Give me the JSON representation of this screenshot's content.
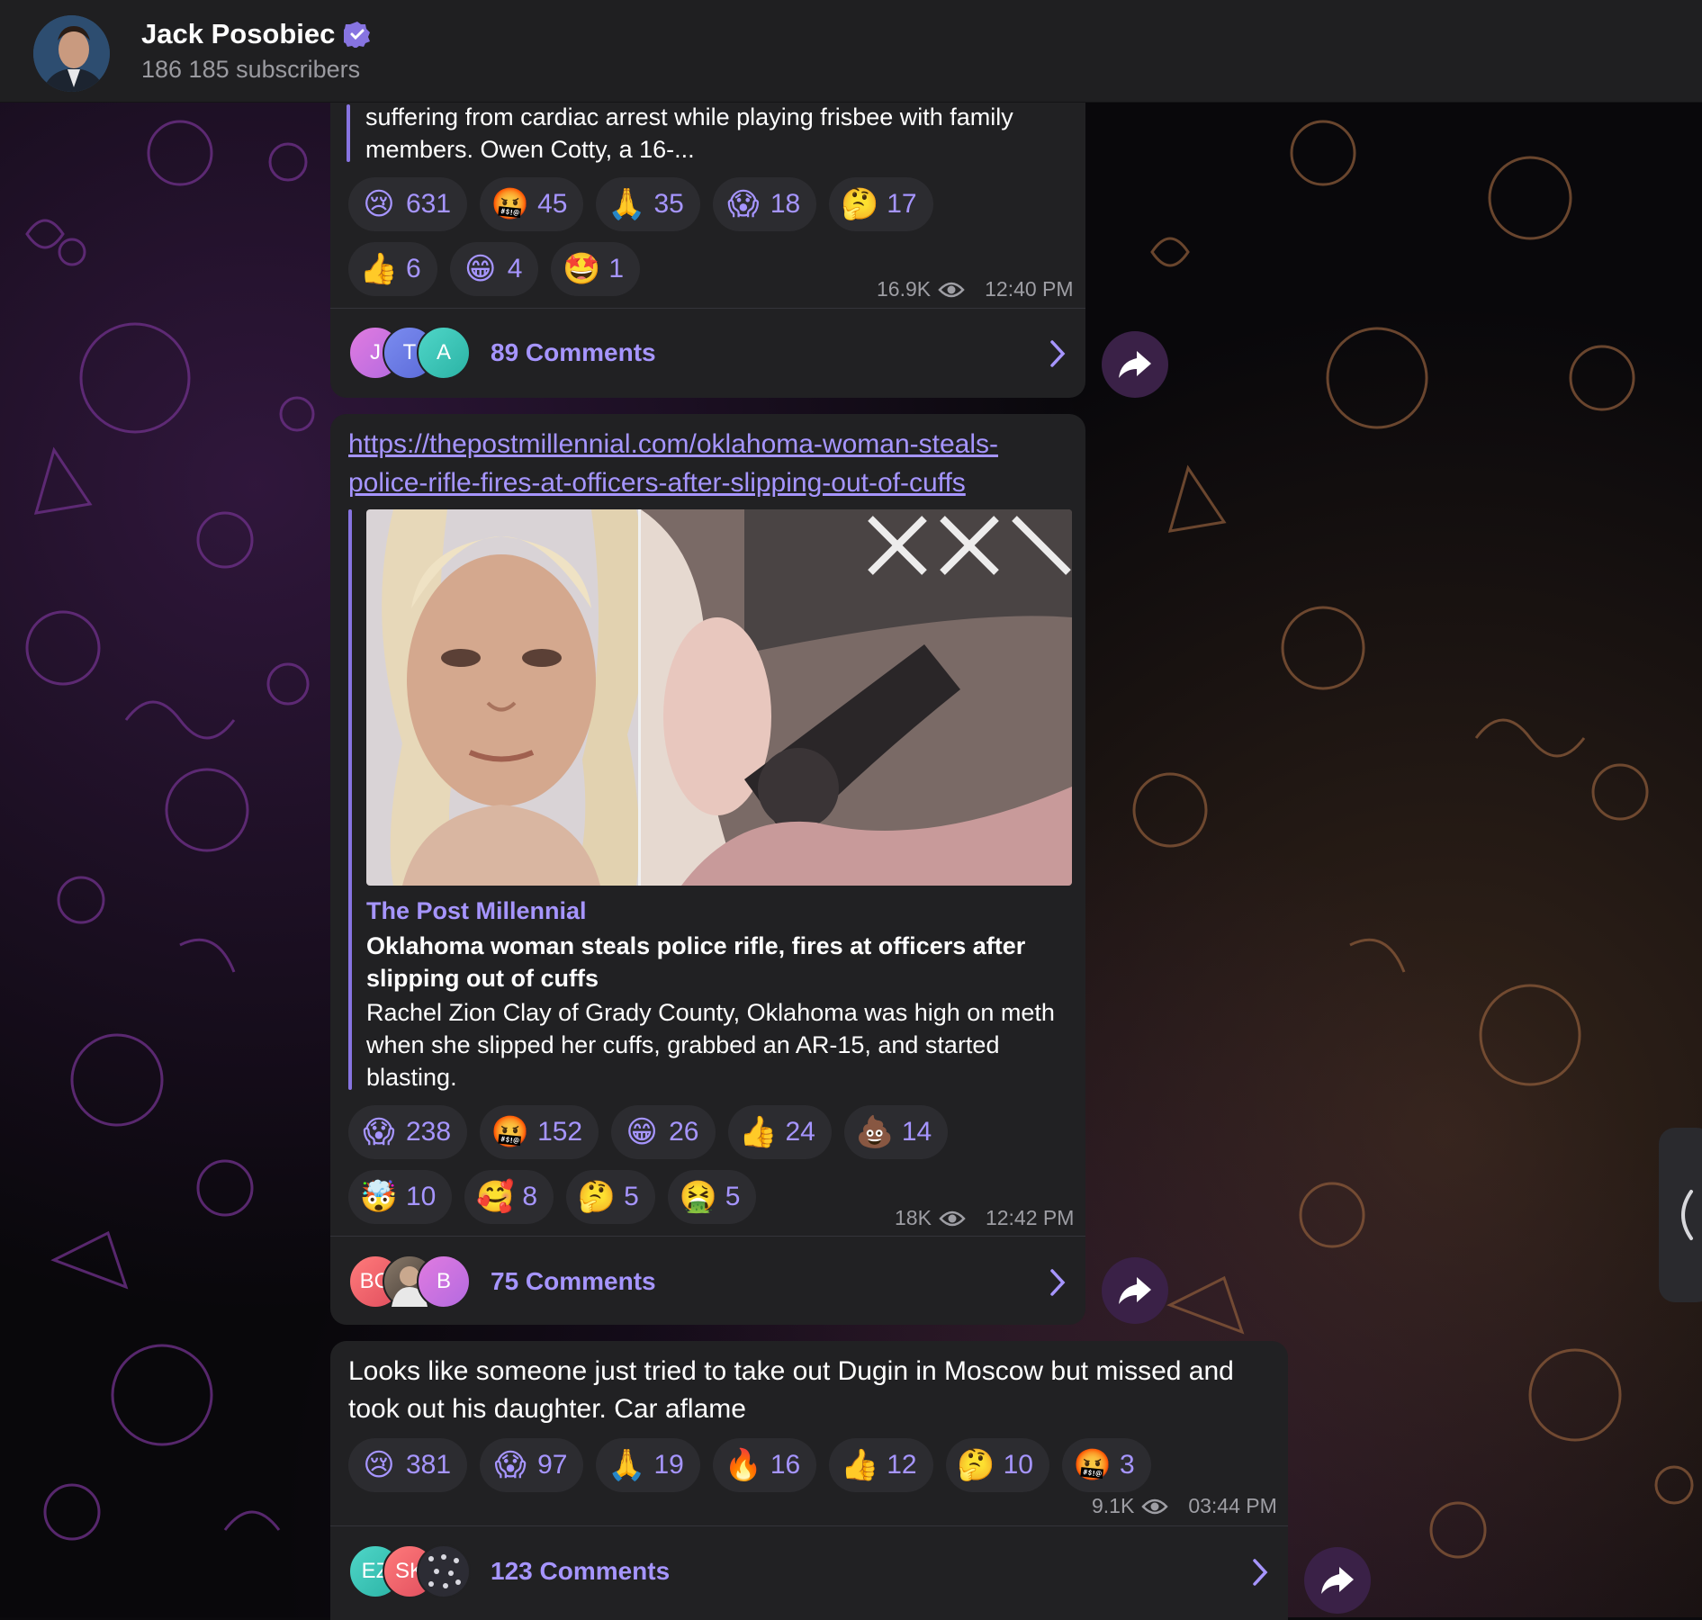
{
  "channel": {
    "name": "Jack Posobiec",
    "subscribers": "186 185 subscribers",
    "accent": "#8774e1"
  },
  "posts": [
    {
      "text": "suffering from cardiac arrest while playing frisbee with family members. Owen Cotty, a 16-...",
      "reactions": [
        {
          "emoji": "😢",
          "count": "631"
        },
        {
          "emoji": "🤬",
          "count": "45"
        },
        {
          "emoji": "🙏",
          "count": "35"
        },
        {
          "emoji": "😱",
          "count": "18"
        },
        {
          "emoji": "🤔",
          "count": "17"
        },
        {
          "emoji": "👍",
          "count": "6"
        },
        {
          "emoji": "😁",
          "count": "4"
        },
        {
          "emoji": "🤩",
          "count": "1"
        }
      ],
      "views": "16.9K",
      "time": "12:40 PM",
      "comment_avatars": [
        "J",
        "T",
        "A"
      ],
      "comments": "89 Comments"
    },
    {
      "link": "https://thepostmillennial.com/oklahoma-woman-steals-police-rifle-fires-at-officers-after-slipping-out-of-cuffs",
      "link_line1": "https://thepostmillennial.com/oklahoma-woman-steals-",
      "link_line2": "police-rifle-fires-at-officers-after-slipping-out-of-cuffs",
      "preview": {
        "site": "The Post Millennial",
        "title": "Oklahoma woman steals police rifle, fires at officers after slipping out of cuffs",
        "description": "Rachel Zion Clay of Grady County, Oklahoma was high on meth when she slipped her cuffs, grabbed an AR-15, and started blasting."
      },
      "reactions": [
        {
          "emoji": "😱",
          "count": "238"
        },
        {
          "emoji": "🤬",
          "count": "152"
        },
        {
          "emoji": "😁",
          "count": "26"
        },
        {
          "emoji": "👍",
          "count": "24"
        },
        {
          "emoji": "💩",
          "count": "14"
        },
        {
          "emoji": "🤯",
          "count": "10"
        },
        {
          "emoji": "🥰",
          "count": "8"
        },
        {
          "emoji": "🤔",
          "count": "5"
        },
        {
          "emoji": "🤮",
          "count": "5"
        }
      ],
      "views": "18K",
      "time": "12:42 PM",
      "comment_avatars": [
        "BG",
        "",
        "B"
      ],
      "comments": "75 Comments"
    },
    {
      "text": "Looks like someone just tried to take out Dugin in Moscow but missed and took out his daughter. Car aflame",
      "reactions": [
        {
          "emoji": "😢",
          "count": "381"
        },
        {
          "emoji": "😱",
          "count": "97"
        },
        {
          "emoji": "🙏",
          "count": "19"
        },
        {
          "emoji": "🔥",
          "count": "16"
        },
        {
          "emoji": "👍",
          "count": "12"
        },
        {
          "emoji": "🤔",
          "count": "10"
        },
        {
          "emoji": "🤬",
          "count": "3"
        }
      ],
      "views": "9.1K",
      "time": "03:44 PM",
      "comment_avatars": [
        "EZ",
        "SK",
        ""
      ],
      "comments": "123 Comments"
    }
  ]
}
